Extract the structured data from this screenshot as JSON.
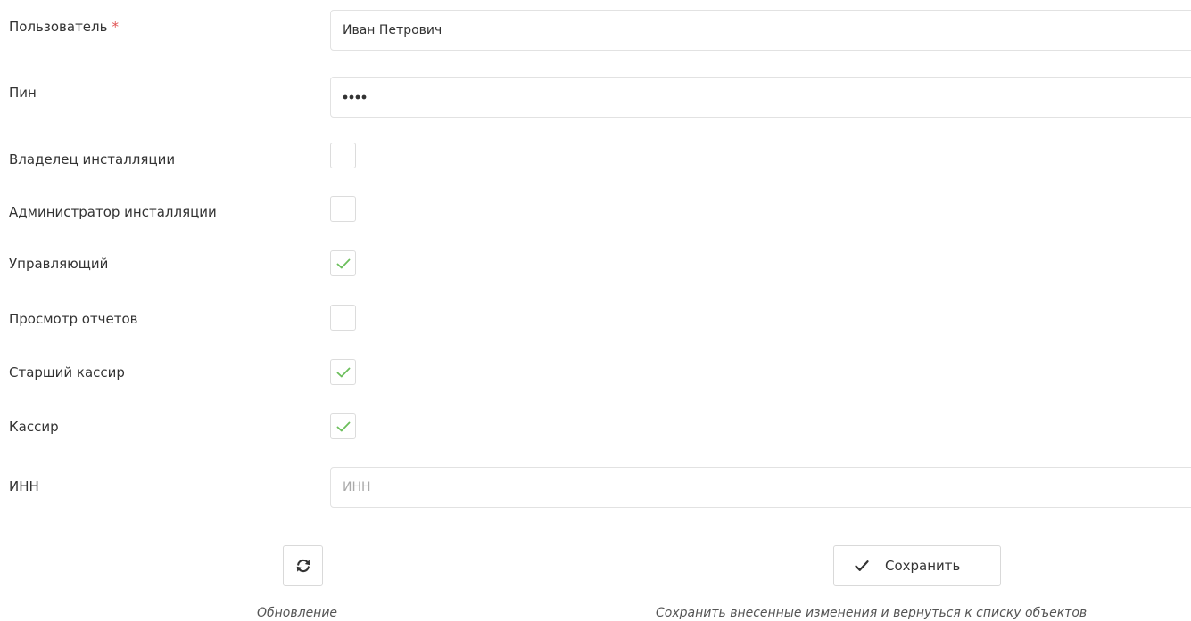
{
  "form": {
    "user": {
      "label": "Пользователь",
      "required_mark": "*",
      "value": "Иван Петрович"
    },
    "pin": {
      "label": "Пин",
      "masked_length": 4
    },
    "roles": [
      {
        "label": "Владелец инсталляции",
        "checked": false
      },
      {
        "label": "Администратор инсталляции",
        "checked": false
      },
      {
        "label": "Управляющий",
        "checked": true
      },
      {
        "label": "Просмотр отчетов",
        "checked": false
      },
      {
        "label": "Старший кассир",
        "checked": true
      },
      {
        "label": "Кассир",
        "checked": true
      }
    ],
    "inn": {
      "label": "ИНН",
      "value": "",
      "placeholder": "ИНН"
    }
  },
  "actions": {
    "refresh": {
      "icon": "refresh-icon",
      "caption": "Обновление"
    },
    "save": {
      "icon": "checkmark-icon",
      "label": "Сохранить",
      "caption": "Сохранить внесенные изменения и вернуться к списку объектов"
    }
  },
  "colors": {
    "required": "#e05252",
    "check": "#6cbf5c",
    "border": "#e2e2e2",
    "text": "#333333"
  }
}
